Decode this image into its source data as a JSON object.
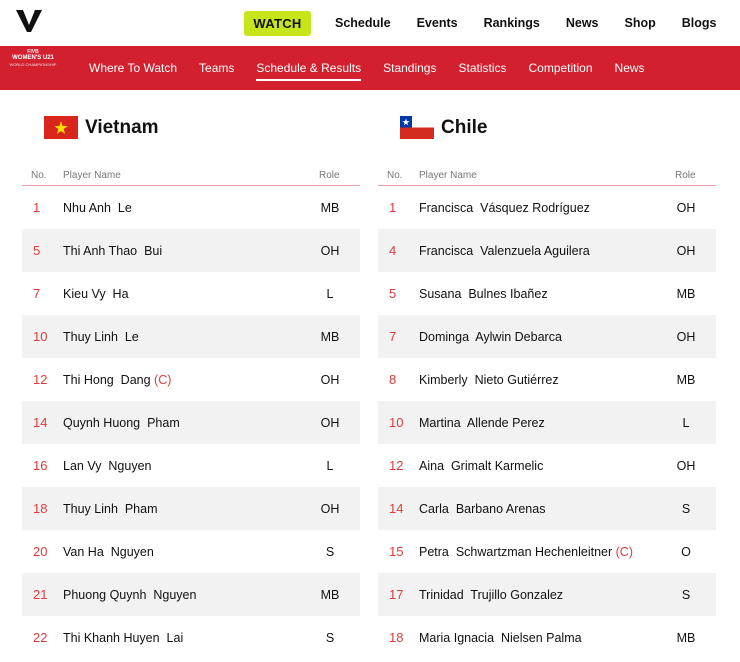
{
  "header": {
    "watch_label": "WATCH",
    "nav": [
      "Schedule",
      "Events",
      "Rankings",
      "News",
      "Shop",
      "Blogs"
    ]
  },
  "event_logo": {
    "line1": "FIVB",
    "line2": "WOMEN'S U21",
    "line3": "WORLD CHAMPIONSHIP"
  },
  "subnav": [
    {
      "label": "Where To Watch",
      "active": false
    },
    {
      "label": "Teams",
      "active": false
    },
    {
      "label": "Schedule & Results",
      "active": true
    },
    {
      "label": "Standings",
      "active": false
    },
    {
      "label": "Statistics",
      "active": false
    },
    {
      "label": "Competition",
      "active": false
    },
    {
      "label": "News",
      "active": false
    }
  ],
  "columns": {
    "no": "No.",
    "name": "Player Name",
    "role": "Role"
  },
  "teams": [
    {
      "name": "Vietnam",
      "flag": "vietnam-flag",
      "players": [
        {
          "no": "1",
          "name": "Nhu Anh  Le",
          "role": "MB"
        },
        {
          "no": "5",
          "name": "Thi Anh Thao  Bui",
          "role": "OH"
        },
        {
          "no": "7",
          "name": "Kieu Vy  Ha",
          "role": "L"
        },
        {
          "no": "10",
          "name": "Thuy Linh  Le",
          "role": "MB"
        },
        {
          "no": "12",
          "name": "Thi Hong  Dang",
          "captain": "(C)",
          "role": "OH"
        },
        {
          "no": "14",
          "name": "Quynh Huong  Pham",
          "role": "OH"
        },
        {
          "no": "16",
          "name": "Lan Vy  Nguyen",
          "role": "L"
        },
        {
          "no": "18",
          "name": "Thuy Linh  Pham",
          "role": "OH"
        },
        {
          "no": "20",
          "name": "Van Ha  Nguyen",
          "role": "S"
        },
        {
          "no": "21",
          "name": "Phuong Quynh  Nguyen",
          "role": "MB"
        },
        {
          "no": "22",
          "name": "Thi Khanh Huyen  Lai",
          "role": "S"
        }
      ]
    },
    {
      "name": "Chile",
      "flag": "chile-flag",
      "players": [
        {
          "no": "1",
          "name": "Francisca  Vásquez Rodríguez",
          "role": "OH"
        },
        {
          "no": "4",
          "name": "Francisca  Valenzuela Aguilera",
          "role": "OH"
        },
        {
          "no": "5",
          "name": "Susana  Bulnes Ibañez",
          "role": "MB"
        },
        {
          "no": "7",
          "name": "Dominga  Aylwin Debarca",
          "role": "OH"
        },
        {
          "no": "8",
          "name": "Kimberly  Nieto Gutiérrez",
          "role": "MB"
        },
        {
          "no": "10",
          "name": "Martina  Allende Perez",
          "role": "L"
        },
        {
          "no": "12",
          "name": "Aina  Grimalt Karmelic",
          "role": "OH"
        },
        {
          "no": "14",
          "name": "Carla  Barbano Arenas",
          "role": "S"
        },
        {
          "no": "15",
          "name": "Petra  Schwartzman Hechenleitner",
          "captain": "(C)",
          "role": "O"
        },
        {
          "no": "17",
          "name": "Trinidad  Trujillo Gonzalez",
          "role": "S"
        },
        {
          "no": "18",
          "name": "Maria Ignacia  Nielsen Palma",
          "role": "MB"
        }
      ]
    }
  ],
  "colors": {
    "accent_red": "#d3202e",
    "watch_green": "#c7e51a",
    "number_red": "#e03c3c"
  }
}
